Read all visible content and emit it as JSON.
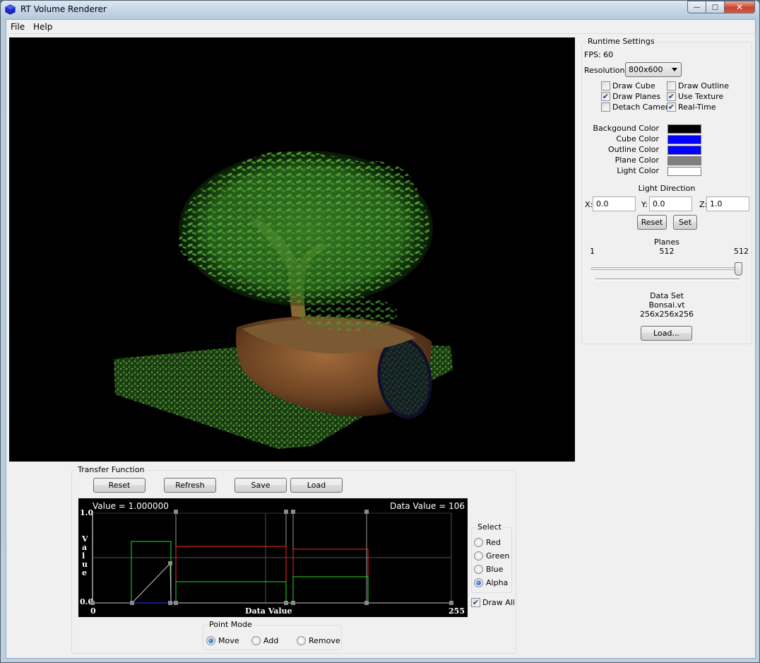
{
  "window": {
    "title": "RT Volume Renderer",
    "controls": {
      "minimize": "—",
      "maximize": "□",
      "close": "✕"
    }
  },
  "menu": [
    "File",
    "Help"
  ],
  "runtime": {
    "title": "Runtime Settings",
    "fps_label": "FPS: 60",
    "resolution_label": "Resolution:",
    "resolution_value": "800x600",
    "checkboxes": [
      {
        "label": "Draw Cube",
        "checked": false
      },
      {
        "label": "Draw Outline",
        "checked": false
      },
      {
        "label": "Draw Planes",
        "checked": true
      },
      {
        "label": "Use Texture",
        "checked": true
      },
      {
        "label": "Detach Camera",
        "checked": false
      },
      {
        "label": "Real-Time",
        "checked": true
      }
    ],
    "colors": [
      {
        "label": "Backgound Color",
        "color": "#000000"
      },
      {
        "label": "Cube Color",
        "color": "#0000ff"
      },
      {
        "label": "Outline Color",
        "color": "#0000ff"
      },
      {
        "label": "Plane Color",
        "color": "#808080"
      },
      {
        "label": "Light Color",
        "color": "#ffffff"
      }
    ],
    "light": {
      "title": "Light Direction",
      "x_label": "X:",
      "x_value": "0.0",
      "y_label": "Y:",
      "y_value": "0.0",
      "z_label": "Z:",
      "z_value": "1.0",
      "reset": "Reset",
      "set": "Set"
    },
    "planes": {
      "title": "Planes",
      "min": "1",
      "current": "512",
      "max": "512",
      "slider_level": 1.0
    },
    "dataset": {
      "title": "Data Set",
      "name": "Bonsai.vt",
      "dims": "256x256x256",
      "load": "Load..."
    }
  },
  "transfer": {
    "title": "Transfer Function",
    "buttons": {
      "reset": "Reset",
      "refresh": "Refresh",
      "save": "Save",
      "load": "Load"
    },
    "value_text": "Value = 1.000000",
    "data_value_text": "Data Value = 106",
    "y_top": "1.0",
    "y_bottom": "0.0",
    "y_label": "Value",
    "x_min": "0",
    "x_max": "255",
    "x_label": "Data Value",
    "colors": {
      "red": "#ff2020",
      "green": "#20e020",
      "blue": "#3030ff",
      "alpha": "#c8c8c8",
      "grid": "#555555",
      "handle": "#8a8a8a"
    },
    "select": {
      "title": "Select",
      "options": [
        {
          "label": "Red",
          "selected": false
        },
        {
          "label": "Green",
          "selected": false
        },
        {
          "label": "Blue",
          "selected": false
        },
        {
          "label": "Alpha",
          "selected": true
        }
      ]
    },
    "draw_all": {
      "label": "Draw All",
      "checked": true
    },
    "point_mode": {
      "title": "Point Mode",
      "options": [
        {
          "label": "Move",
          "selected": true
        },
        {
          "label": "Add",
          "selected": false
        },
        {
          "label": "Remove",
          "selected": false
        }
      ]
    }
  }
}
